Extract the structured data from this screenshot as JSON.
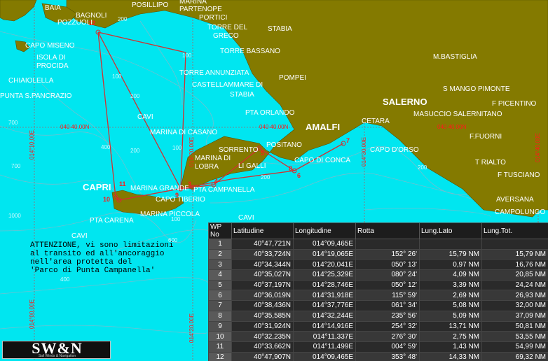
{
  "map": {
    "colors": {
      "sea": "#00e6f0",
      "land": "#847a00",
      "route": "#d23030",
      "contour": "#6fc0d0"
    },
    "places": [
      "BAIA",
      "POSILLIPO",
      "MARINA",
      "PARTENOPE",
      "PORTICI",
      "BAGNOLI",
      "POZZUOLI",
      "TORRE DEL",
      "GRECO",
      "STABIA",
      "TORRE BASSANO",
      "CAPO MISENO",
      "ISOLA DI",
      "PROCIDA",
      "CHIAIOLELLA",
      "PUNTA S.PANCRAZIO",
      "TORRE ANNUNZIATA",
      "POMPEI",
      "CASTELLAMMARE DI",
      "STABIA",
      "PTA ORLANDO",
      "M.BASTIGLIA",
      "S MANGO PIMONTE",
      "SALERNO",
      "F PICENTINO",
      "MASUCCIO SALERNITANO",
      "AMALFI",
      "CETARA",
      "F.FUORNI",
      "MARINA DI CASANO",
      "SORRENTO",
      "POSITANO",
      "CAPO D'ORSO",
      "MARINA DI",
      "LOBRA",
      "LI GALLI",
      "CAPO DI CONCA",
      "T RIALTO",
      "F TUSCIANO",
      "CAPRI",
      "MARINA GRANDE",
      "PTA CAMPANELLA",
      "CAPO TIBERIO",
      "AVERSANA",
      "PTA CARENA",
      "MARINA PICCOLA",
      "CAMPOLUNGO",
      "CAVI",
      "CAVI",
      "CAVI"
    ],
    "grid_labels": {
      "lat_40_40_00": "040 40.00N",
      "lat_40_40_00_right": "040 40.00N",
      "lon_14_10": "014°10.00E",
      "lon_14_20_upper": "014°20.00E",
      "lon_14_20_lower": "014°20.00E",
      "lon_14_30": "014°30.00E",
      "lon_14_40": "014°40.00E",
      "lon_14_50": "014°50.00E",
      "lon_14_00_bottom": "014°00.00E"
    },
    "depths": [
      "700",
      "700",
      "400",
      "1000",
      "200",
      "100",
      "100",
      "200",
      "100",
      "200",
      "200",
      "600",
      "400",
      "100",
      "200",
      "500",
      "100",
      "100",
      "100",
      "100",
      "100",
      "200",
      "200",
      "100",
      "200"
    ],
    "wp_markers": [
      "10",
      "11",
      "3",
      "4",
      "5",
      "6",
      "7",
      "8",
      "9",
      "12"
    ]
  },
  "notice": {
    "lines": [
      "ATTENZIONE, vi sono limitazioni",
      "al transito ed all'ancoraggio",
      "nell'area protetta del",
      "'Parco di Punta Campanella'"
    ]
  },
  "waypoints": {
    "headers": [
      "WP No",
      "Latitudine",
      "Longitudine",
      "Rotta",
      "Lung.Lato",
      "Lung.Tot."
    ],
    "rows": [
      [
        "1",
        "40°47,721N",
        "014°09,465E",
        "",
        "",
        ""
      ],
      [
        "2",
        "40°33,724N",
        "014°19,065E",
        "152° 26'",
        "15,79 NM",
        "15,79 NM"
      ],
      [
        "3",
        "40°34,344N",
        "014°20,041E",
        "050° 13'",
        "0,97 NM",
        "16,76 NM"
      ],
      [
        "4",
        "40°35,027N",
        "014°25,329E",
        "080° 24'",
        "4,09 NM",
        "20,85 NM"
      ],
      [
        "5",
        "40°37,197N",
        "014°28,746E",
        "050° 12'",
        "3,39 NM",
        "24,24 NM"
      ],
      [
        "6",
        "40°36,019N",
        "014°31,918E",
        "115° 59'",
        "2,69 NM",
        "26,93 NM"
      ],
      [
        "7",
        "40°38,436N",
        "014°37,776E",
        "061° 34'",
        "5,08 NM",
        "32,00 NM"
      ],
      [
        "8",
        "40°35,585N",
        "014°32,244E",
        "235° 56'",
        "5,09 NM",
        "37,09 NM"
      ],
      [
        "9",
        "40°31,924N",
        "014°14,916E",
        "254° 32'",
        "13,71 NM",
        "50,81 NM"
      ],
      [
        "10",
        "40°32,235N",
        "014°11,337E",
        "276° 30'",
        "2,75 NM",
        "53,55 NM"
      ],
      [
        "11",
        "40°33,662N",
        "014°11,499E",
        "004° 59'",
        "1,43 NM",
        "54,99 NM"
      ],
      [
        "12",
        "40°47,907N",
        "014°09,465E",
        "353° 48'",
        "14,33 NM",
        "69,32 NM"
      ]
    ]
  },
  "logo": {
    "text": "SW&N",
    "sub": "Sail Winds & Navigation"
  }
}
